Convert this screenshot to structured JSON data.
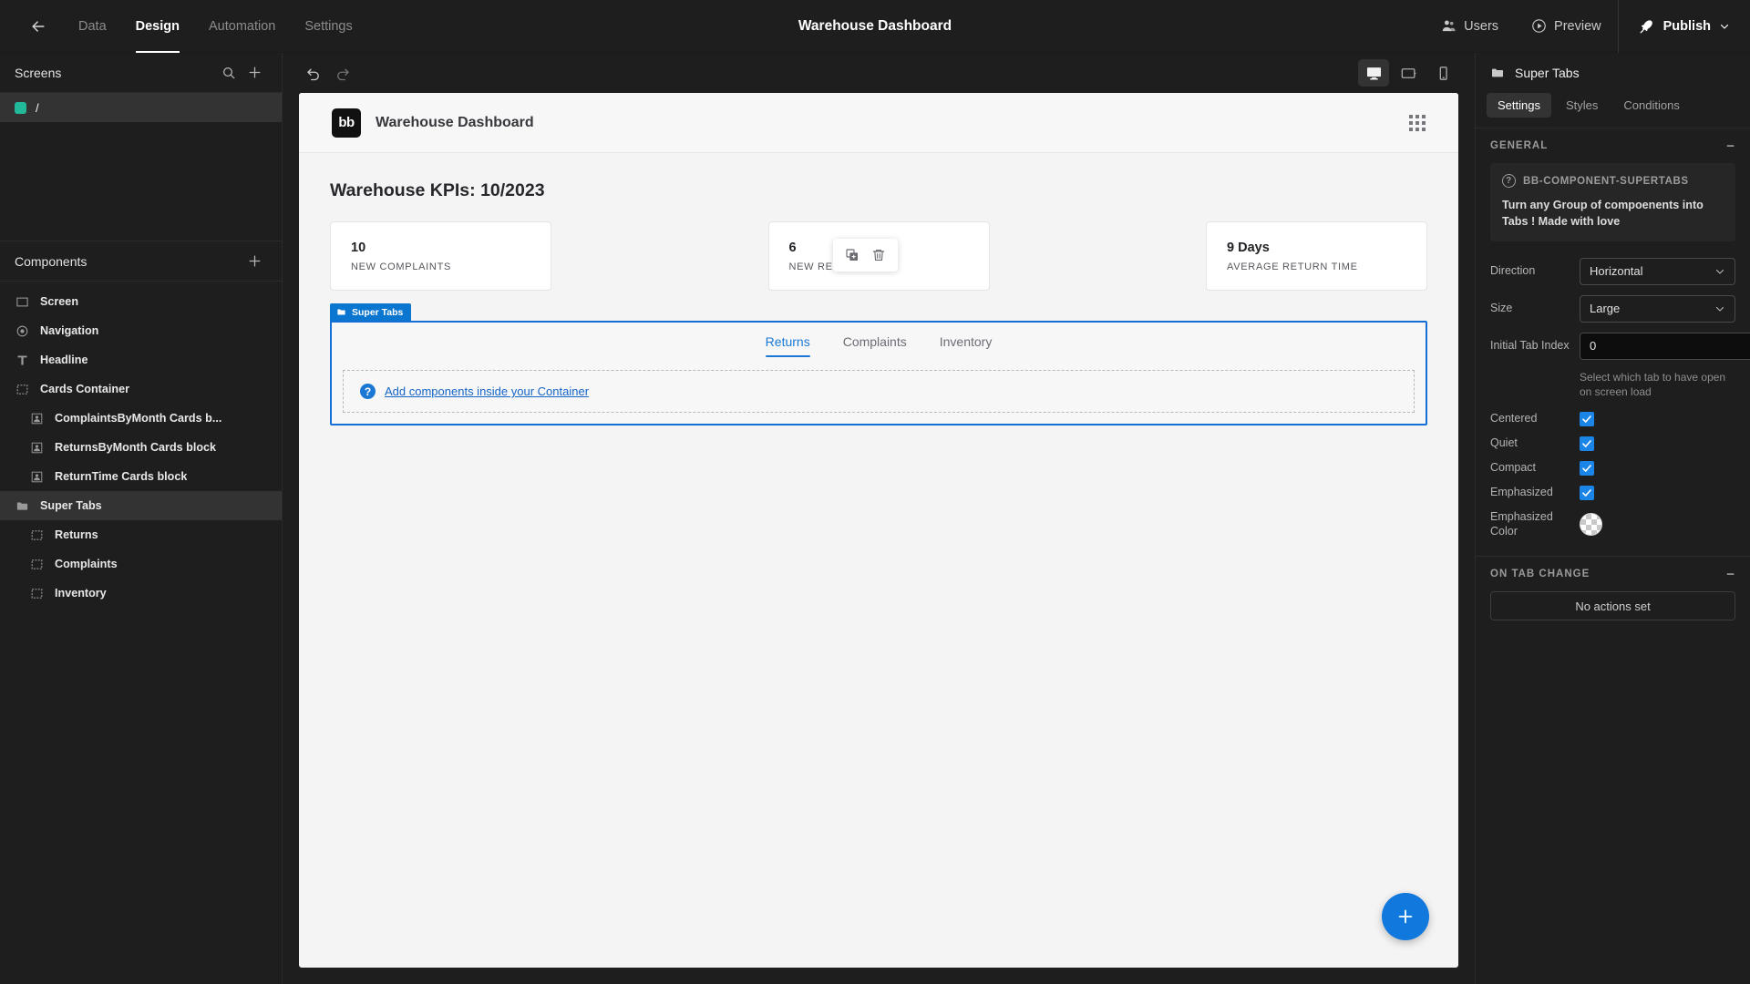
{
  "topbar": {
    "back_icon": "arrow-left-icon",
    "nav": [
      {
        "label": "Data",
        "active": false
      },
      {
        "label": "Design",
        "active": true
      },
      {
        "label": "Automation",
        "active": false
      },
      {
        "label": "Settings",
        "active": false
      }
    ],
    "title": "Warehouse Dashboard",
    "users_label": "Users",
    "preview_label": "Preview",
    "publish_label": "Publish"
  },
  "sidebar": {
    "screens": {
      "title": "Screens",
      "search_icon": "search-icon",
      "add_icon": "plus-icon",
      "items": [
        {
          "label": "/",
          "color": "#22b99a",
          "selected": true
        }
      ]
    },
    "components": {
      "title": "Components",
      "add_icon": "plus-icon",
      "items": [
        {
          "label": "Screen",
          "icon": "screen-icon",
          "indent": 0,
          "selected": false
        },
        {
          "label": "Navigation",
          "icon": "navigation-icon",
          "indent": 0,
          "selected": false
        },
        {
          "label": "Headline",
          "icon": "text-icon",
          "indent": 0,
          "selected": false
        },
        {
          "label": "Cards Container",
          "icon": "container-icon",
          "indent": 0,
          "selected": false
        },
        {
          "label": "ComplaintsByMonth Cards b...",
          "icon": "card-block-icon",
          "indent": 1,
          "selected": false
        },
        {
          "label": "ReturnsByMonth Cards block",
          "icon": "card-block-icon",
          "indent": 1,
          "selected": false
        },
        {
          "label": "ReturnTime Cards block",
          "icon": "card-block-icon",
          "indent": 1,
          "selected": false
        },
        {
          "label": "Super Tabs",
          "icon": "folder-icon",
          "indent": 0,
          "selected": true
        },
        {
          "label": "Returns",
          "icon": "container-icon",
          "indent": 1,
          "selected": false
        },
        {
          "label": "Complaints",
          "icon": "container-icon",
          "indent": 1,
          "selected": false
        },
        {
          "label": "Inventory",
          "icon": "container-icon",
          "indent": 1,
          "selected": false
        }
      ]
    }
  },
  "toolbar": {
    "undo_icon": "undo-icon",
    "redo_icon": "redo-icon",
    "devices": [
      {
        "name": "desktop-icon",
        "active": true
      },
      {
        "name": "tablet-icon",
        "active": false
      },
      {
        "name": "mobile-icon",
        "active": false
      }
    ]
  },
  "canvas": {
    "app_logo_text": "bb",
    "app_title": "Warehouse Dashboard",
    "grid_icon": "grid-dots-icon",
    "page_title": "Warehouse KPIs: 10/2023",
    "cards": [
      {
        "value": "10",
        "label": "NEW COMPLAINTS"
      },
      {
        "value": "6",
        "label": "NEW RETURNS"
      },
      {
        "value": "9 Days",
        "label": "AVERAGE RETURN TIME"
      }
    ],
    "hover_toolbar": {
      "duplicate_icon": "duplicate-icon",
      "delete_icon": "trash-icon"
    },
    "supertabs": {
      "tag_label": "Super Tabs",
      "tag_icon": "folder-icon",
      "tabs": [
        {
          "label": "Returns",
          "active": true
        },
        {
          "label": "Complaints",
          "active": false
        },
        {
          "label": "Inventory",
          "active": false
        }
      ],
      "dropzone_icon": "question-icon",
      "dropzone_link": "Add components inside your Container"
    },
    "fab_icon": "plus-icon",
    "fab_label": "+"
  },
  "rightpanel": {
    "header_icon": "folder-icon",
    "header_title": "Super Tabs",
    "tabs": [
      {
        "label": "Settings",
        "active": true
      },
      {
        "label": "Styles",
        "active": false
      },
      {
        "label": "Conditions",
        "active": false
      }
    ],
    "general": {
      "section_title": "GENERAL",
      "collapse_icon": "minus-icon",
      "info": {
        "icon": "question-circle-icon",
        "title": "BB-COMPONENT-SUPERTABS",
        "text": "Turn any Group of compoenents into Tabs ! Made with love"
      },
      "fields": {
        "direction_label": "Direction",
        "direction_value": "Horizontal",
        "size_label": "Size",
        "size_value": "Large",
        "initial_tab_label": "Initial Tab Index",
        "initial_tab_value": "0",
        "initial_tab_hint": "Select which tab to have open on screen load",
        "centered_label": "Centered",
        "centered_checked": true,
        "quiet_label": "Quiet",
        "quiet_checked": true,
        "compact_label": "Compact",
        "compact_checked": true,
        "emphasized_label": "Emphasized",
        "emphasized_checked": true,
        "emphasized_color_label": "Emphasized Color",
        "emphasized_color_value": "transparent"
      }
    },
    "on_tab_change": {
      "section_title": "ON TAB CHANGE",
      "collapse_icon": "minus-icon",
      "no_actions_label": "No actions set"
    }
  },
  "colors": {
    "accent_blue": "#1178dd",
    "select_blue": "#1570d6",
    "screen_green": "#22b99a",
    "panel_bg": "#1e1e1e",
    "canvas_bg": "#f4f4f5"
  }
}
